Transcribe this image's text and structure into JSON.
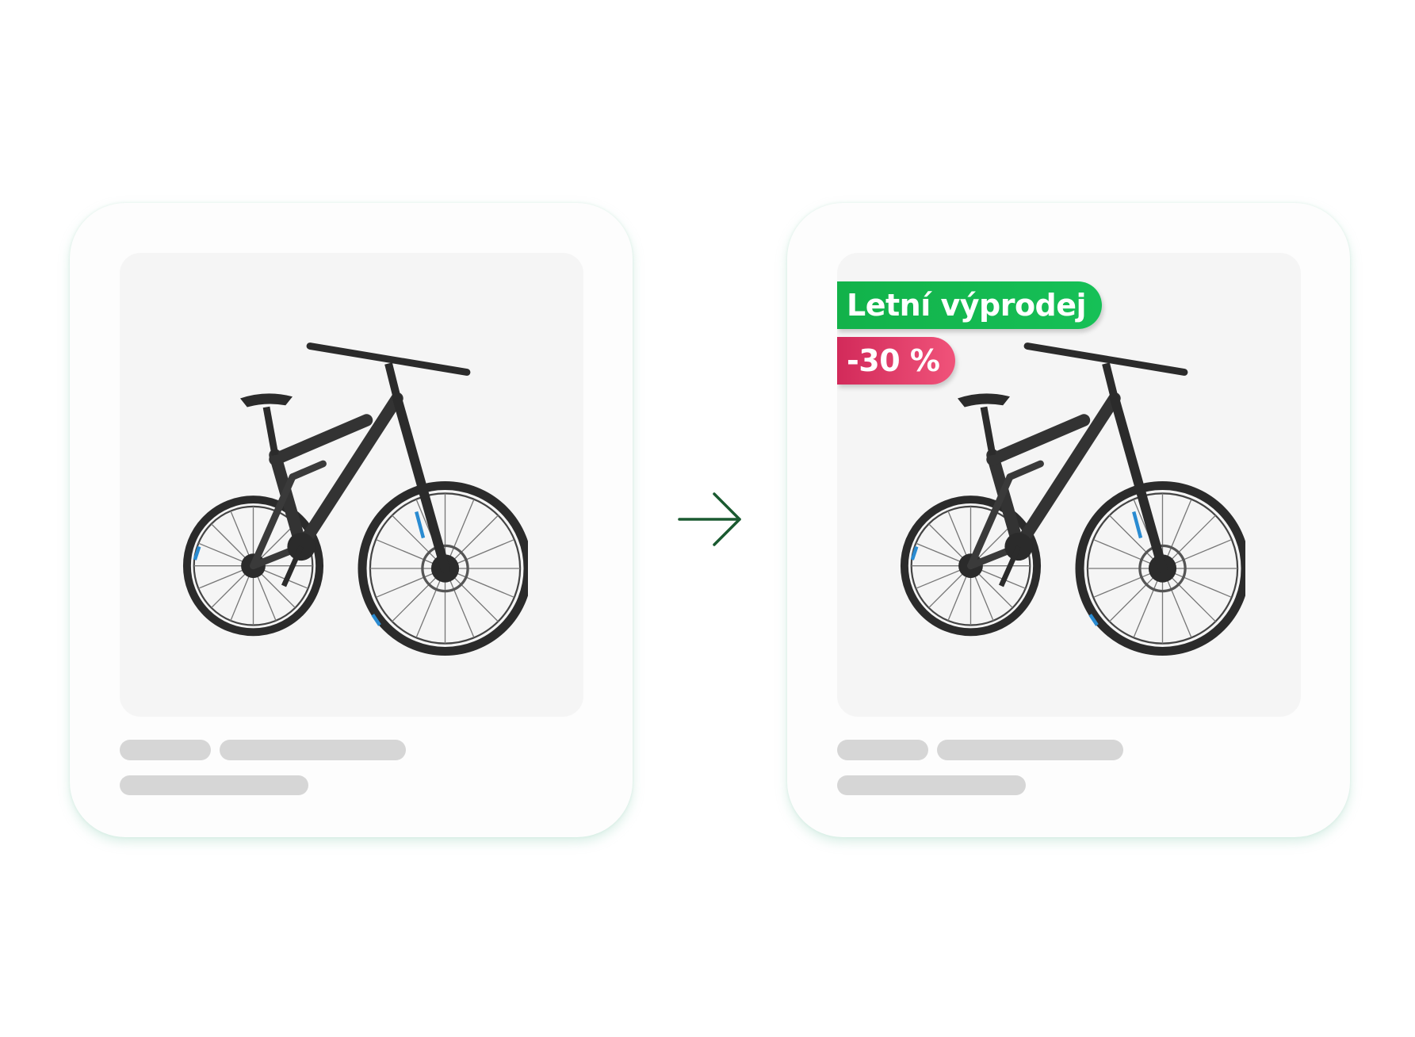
{
  "cards": [
    {
      "id": "before",
      "badges": []
    },
    {
      "id": "after",
      "badges": [
        {
          "text": "Letní výprodej",
          "color": "#12b24a"
        },
        {
          "text": "-30 %",
          "color": "#e33f6e"
        }
      ]
    }
  ],
  "arrow": {
    "icon": "arrow-right-icon",
    "color": "#1a5a30"
  },
  "colors": {
    "card_bg": "#fdfdfd",
    "image_bg": "#f5f5f5",
    "skeleton": "#d6d6d6"
  }
}
